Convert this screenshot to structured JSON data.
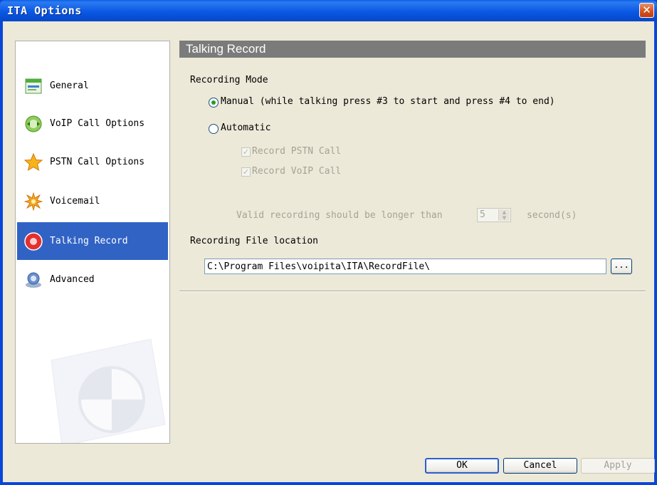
{
  "window": {
    "title": "ITA Options",
    "close_glyph": "✕"
  },
  "sidebar": {
    "items": [
      {
        "label": "General",
        "icon": "general-settings-icon",
        "active": false
      },
      {
        "label": "VoIP Call Options",
        "icon": "voip-call-icon",
        "active": false
      },
      {
        "label": "PSTN Call Options",
        "icon": "star-icon",
        "active": false
      },
      {
        "label": "Voicemail",
        "icon": "voicemail-icon",
        "active": false
      },
      {
        "label": "Talking Record",
        "icon": "record-icon",
        "active": true
      },
      {
        "label": "Advanced",
        "icon": "advanced-icon",
        "active": false
      }
    ]
  },
  "content": {
    "header": "Talking Record",
    "recording_mode": {
      "label": "Recording Mode",
      "manual_label": "Manual  (while talking press #3 to start and press #4 to end)",
      "manual_selected": true,
      "automatic_label": "Automatic",
      "automatic_selected": false,
      "record_pstn_label": "Record PSTN Call",
      "record_pstn_checked": true,
      "record_voip_label": "Record VoIP Call",
      "record_voip_checked": true,
      "valid_label": "Valid recording should be longer than",
      "valid_value": "5",
      "valid_unit": "second(s)"
    },
    "file_location": {
      "label": "Recording File location",
      "path": "C:\\Program Files\\voipita\\ITA\\RecordFile\\",
      "browse_label": "..."
    }
  },
  "footer": {
    "ok": "OK",
    "cancel": "Cancel",
    "apply": "Apply"
  },
  "colors": {
    "title_bar": "#0a58e4",
    "selected_item": "#3163c5",
    "section_header": "#7b7b7b",
    "dialog_bg": "#ece9d8",
    "radio_dot": "#21a121",
    "close_button": "#d4501c"
  }
}
